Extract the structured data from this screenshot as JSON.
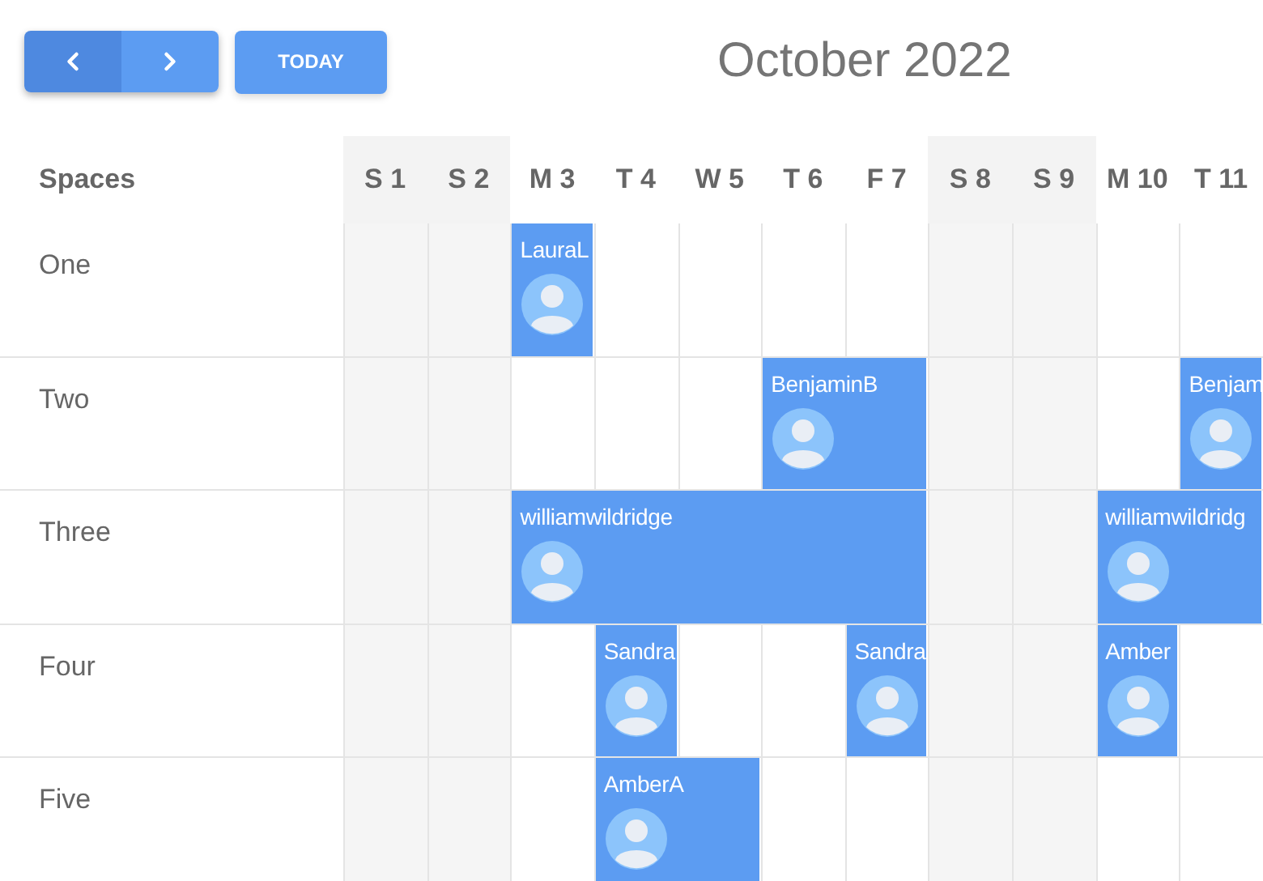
{
  "toolbar": {
    "today_button": "TODAY",
    "title": "October 2022"
  },
  "resource_header": "Spaces",
  "days": [
    {
      "label": "S 1",
      "weekend": true
    },
    {
      "label": "S 2",
      "weekend": true
    },
    {
      "label": "M 3",
      "weekend": false
    },
    {
      "label": "T 4",
      "weekend": false
    },
    {
      "label": "W 5",
      "weekend": false
    },
    {
      "label": "T 6",
      "weekend": false
    },
    {
      "label": "F 7",
      "weekend": false
    },
    {
      "label": "S 8",
      "weekend": true
    },
    {
      "label": "S 9",
      "weekend": true
    },
    {
      "label": "M 10",
      "weekend": false
    },
    {
      "label": "T 11",
      "weekend": false
    }
  ],
  "resources": [
    {
      "name": "One",
      "cells": [
        {
          "kind": "free"
        },
        {
          "kind": "free"
        },
        {
          "kind": "booking",
          "title": "LauraL"
        },
        {
          "kind": "free"
        },
        {
          "kind": "free"
        },
        {
          "kind": "free"
        },
        {
          "kind": "free"
        },
        {
          "kind": "free"
        },
        {
          "kind": "free"
        },
        {
          "kind": "free"
        },
        {
          "kind": "free"
        }
      ]
    },
    {
      "name": "Two",
      "cells": [
        {
          "kind": "free"
        },
        {
          "kind": "free"
        },
        {
          "kind": "free"
        },
        {
          "kind": "free"
        },
        {
          "kind": "free"
        },
        {
          "kind": "booking",
          "title": "BenjaminB"
        },
        {
          "kind": "continued"
        },
        {
          "kind": "free"
        },
        {
          "kind": "free"
        },
        {
          "kind": "free"
        },
        {
          "kind": "booking",
          "title": "Benjam"
        }
      ]
    },
    {
      "name": "Three",
      "cells": [
        {
          "kind": "free"
        },
        {
          "kind": "free"
        },
        {
          "kind": "booking",
          "title": "williamwildridge"
        },
        {
          "kind": "continued"
        },
        {
          "kind": "continued"
        },
        {
          "kind": "continued"
        },
        {
          "kind": "continued"
        },
        {
          "kind": "free"
        },
        {
          "kind": "free"
        },
        {
          "kind": "booking",
          "title": "williamwildridg"
        },
        {
          "kind": "continued"
        }
      ]
    },
    {
      "name": "Four",
      "cells": [
        {
          "kind": "free"
        },
        {
          "kind": "free"
        },
        {
          "kind": "free"
        },
        {
          "kind": "booking",
          "title": "Sandra"
        },
        {
          "kind": "free"
        },
        {
          "kind": "free"
        },
        {
          "kind": "booking",
          "title": "Sandra"
        },
        {
          "kind": "free"
        },
        {
          "kind": "free"
        },
        {
          "kind": "booking",
          "title": "Amber"
        },
        {
          "kind": "free"
        }
      ]
    },
    {
      "name": "Five",
      "cells": [
        {
          "kind": "free"
        },
        {
          "kind": "free"
        },
        {
          "kind": "free"
        },
        {
          "kind": "booking",
          "title": "AmberA"
        },
        {
          "kind": "continued"
        },
        {
          "kind": "free"
        },
        {
          "kind": "free"
        },
        {
          "kind": "free"
        },
        {
          "kind": "free"
        },
        {
          "kind": "free"
        },
        {
          "kind": "free"
        }
      ]
    }
  ]
}
